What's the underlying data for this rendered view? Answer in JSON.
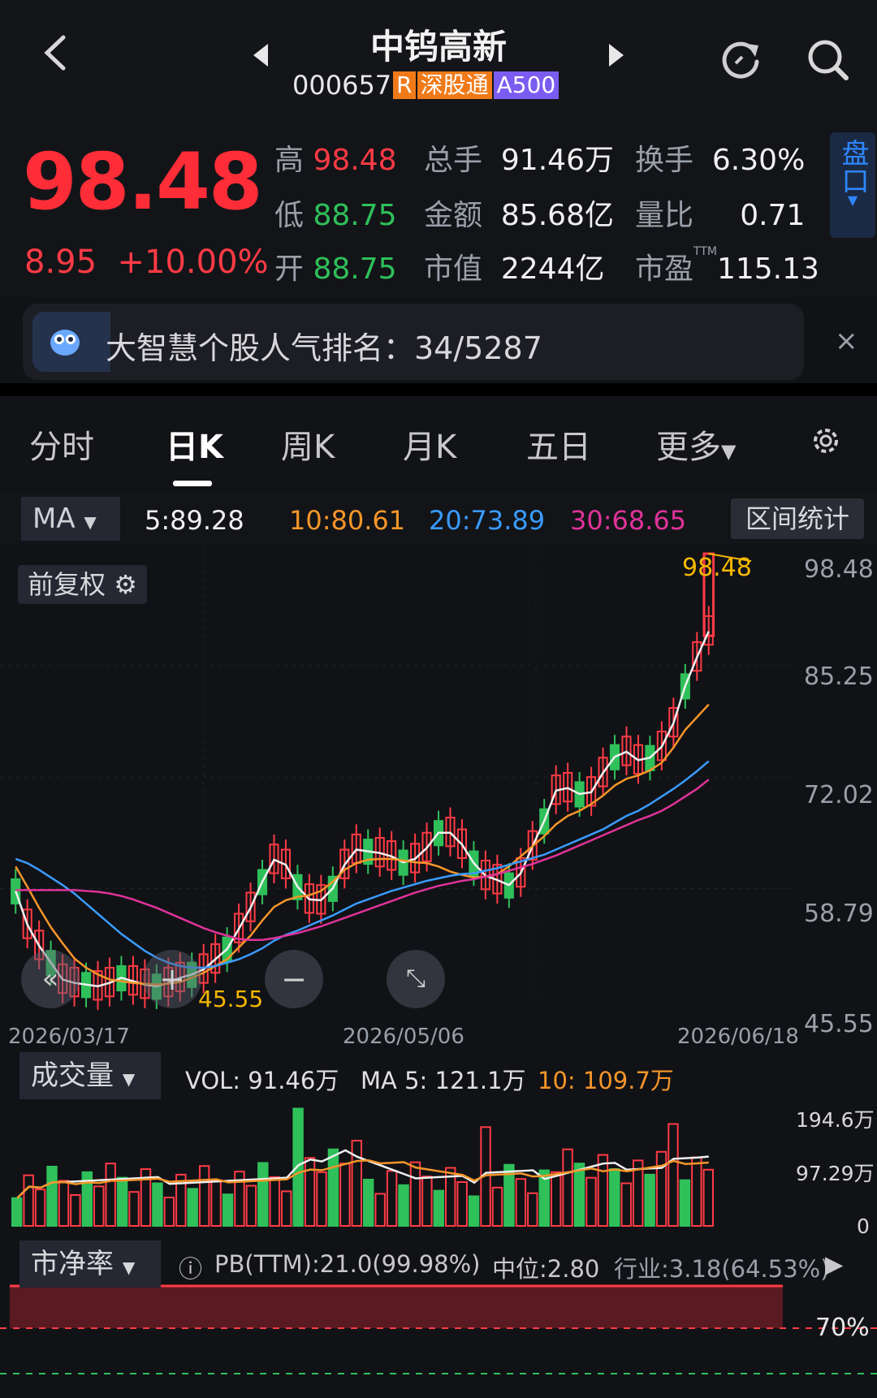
{
  "header": {
    "back_icon": "back-chevron-icon",
    "prev_icon": "left-triangle-icon",
    "next_icon": "right-triangle-icon",
    "title": "中钨高新",
    "code": "000657",
    "tags": [
      {
        "text": "R",
        "color": "#f07a18"
      },
      {
        "text": "深股通",
        "color": "#f07a18"
      },
      {
        "text": "A500",
        "color": "#7b5cf0"
      }
    ],
    "refresh_icon": "refresh-icon",
    "search_icon": "search-icon"
  },
  "quote": {
    "price": "98.48",
    "change": "8.95",
    "change_pct": "+10.00%",
    "stats": [
      {
        "label": "高",
        "value": "98.48",
        "color": "red"
      },
      {
        "label": "总手",
        "value": "91.46万",
        "color": "wht"
      },
      {
        "label": "换手",
        "value": "6.30%",
        "color": "wht"
      },
      {
        "label": "低",
        "value": "88.75",
        "color": "grn"
      },
      {
        "label": "金额",
        "value": "85.68亿",
        "color": "wht"
      },
      {
        "label": "量比",
        "value": "0.71",
        "color": "wht"
      },
      {
        "label": "开",
        "value": "88.75",
        "color": "grn"
      },
      {
        "label": "市值",
        "value": "2244亿",
        "color": "wht"
      },
      {
        "label": "市盈",
        "value": "115.13",
        "color": "wht"
      }
    ],
    "pe_badge": "TTM",
    "pankou": "盘口"
  },
  "banner": {
    "text": "大智慧个股人气排名：34/5287",
    "close": "×"
  },
  "tabs": [
    "分时",
    "日K",
    "周K",
    "月K",
    "五日",
    "更多"
  ],
  "ma_row": {
    "selector": "MA",
    "values": [
      {
        "text": "5:89.28",
        "color": "#f0f0f0"
      },
      {
        "text": "10:80.61",
        "color": "#f5962a"
      },
      {
        "text": "20:73.89",
        "color": "#3a9bff"
      },
      {
        "text": "30:68.65",
        "color": "#e0339a"
      }
    ],
    "range_button": "区间统计"
  },
  "kline": {
    "adjust_label": "前复权",
    "y_ticks": [
      "98.48",
      "85.25",
      "72.02",
      "58.79",
      "45.55"
    ],
    "dates": [
      "2026/03/17",
      "2026/05/06",
      "2026/06/18"
    ],
    "high_label": "98.48",
    "low_label": "45.55"
  },
  "volume": {
    "selector": "成交量",
    "vol": "VOL: 91.46万",
    "ma5": "MA 5: 121.1万",
    "ma10": "10: 109.7万",
    "y_ticks": [
      "194.6万",
      "97.29万",
      "0"
    ]
  },
  "pb": {
    "selector": "市净率",
    "info_icon": "info-icon",
    "pb": "PB(TTM):21.0(99.98%)",
    "median": "中位:2.80",
    "industry": "行业:3.18(64.53%)",
    "pct_label": "70%"
  },
  "chart_data": {
    "type": "candlestick",
    "y_range": [
      45.55,
      98.48
    ],
    "ma_lines": [
      {
        "name": "MA5",
        "color": "#f0f0f0",
        "values": [
          58.5,
          54.5,
          52,
          50,
          48,
          47.6,
          47.4,
          47.2,
          47.6,
          48.2,
          47.8,
          47.4,
          47.2,
          47.6,
          48.2,
          48.6,
          49.2,
          50.4,
          51.6,
          54,
          56.5,
          59.6,
          62.2,
          61.6,
          59,
          57.5,
          57.4,
          58.8,
          61.6,
          63.4,
          63.2,
          63,
          62.6,
          61.9,
          62.3,
          63.6,
          65.4,
          65.4,
          64,
          61.8,
          60.3,
          59.8,
          59.2,
          60.6,
          63.8,
          66.8,
          70.4,
          70.7,
          70,
          70.2,
          72.5,
          74.4,
          75,
          74,
          74.3,
          75.6,
          78.4,
          82.8,
          86.2,
          89.28
        ]
      },
      {
        "name": "MA10",
        "color": "#f5962a",
        "values": [
          61.4,
          59,
          56.5,
          54.2,
          52.3,
          50.5,
          49.4,
          48.6,
          48,
          47.8,
          47.6,
          47.5,
          47.4,
          47.5,
          47.7,
          48.2,
          48.8,
          49.6,
          50.4,
          51.8,
          53.2,
          55,
          56.6,
          57.4,
          57.8,
          58,
          58.5,
          59.6,
          61,
          61.8,
          62.2,
          62.3,
          62.3,
          62.1,
          61.9,
          61.8,
          61.4,
          60.8,
          60.4,
          60.1,
          60.2,
          60.5,
          61.4,
          62.6,
          63.8,
          65,
          66.4,
          67.4,
          68,
          68.8,
          69.8,
          71,
          71.8,
          72.2,
          72.8,
          73.7,
          75.5,
          77.6,
          79.1,
          80.61
        ]
      },
      {
        "name": "MA20",
        "color": "#3a9bff",
        "values": [
          62.3,
          61.8,
          61,
          60.1,
          59.2,
          58.2,
          57,
          55.8,
          54.6,
          53.4,
          52.4,
          51.4,
          50.6,
          50,
          49.6,
          49.4,
          49.4,
          49.6,
          50,
          50.4,
          51,
          51.7,
          52.6,
          53.3,
          53.8,
          54.4,
          55,
          55.6,
          56.3,
          57,
          57.5,
          58,
          58.5,
          58.9,
          59.3,
          59.7,
          60,
          60.3,
          60.5,
          60.6,
          60.9,
          61.2,
          61.6,
          62,
          62.4,
          62.8,
          63.4,
          64,
          64.6,
          65.2,
          65.8,
          66.6,
          67.4,
          68,
          68.8,
          69.7,
          70.6,
          71.6,
          72.7,
          73.89
        ]
      },
      {
        "name": "MA30",
        "color": "#e0339a",
        "values": [
          58.6,
          58.6,
          58.6,
          58.6,
          58.6,
          58.6,
          58.5,
          58.4,
          58.2,
          57.9,
          57.5,
          57,
          56.5,
          55.9,
          55.3,
          54.7,
          54.1,
          53.6,
          53.2,
          52.8,
          52.7,
          52.7,
          52.9,
          53.2,
          53.5,
          53.9,
          54.3,
          54.8,
          55.3,
          55.8,
          56.3,
          56.8,
          57.3,
          57.8,
          58.3,
          58.7,
          59.1,
          59.4,
          59.7,
          59.9,
          60.2,
          60.5,
          60.9,
          61.3,
          61.7,
          62.2,
          62.7,
          63.3,
          63.9,
          64.5,
          65.1,
          65.7,
          66.3,
          66.9,
          67.4,
          68,
          68.8,
          69.7,
          70.6,
          71.7,
          68.65
        ]
      }
    ]
  }
}
